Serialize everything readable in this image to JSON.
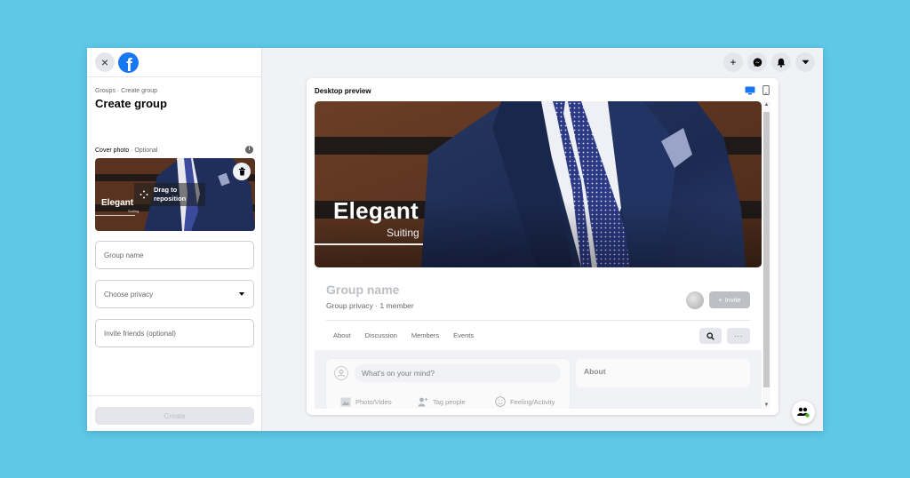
{
  "sidebar": {
    "close_label": "×",
    "logo_letter": "f",
    "breadcrumb": "Groups · Create group",
    "title": "Create group",
    "cover_label": "Cover photo",
    "cover_optional": " · Optional",
    "info_glyph": "i",
    "drag_hint_line1": "Drag to",
    "drag_hint_line2": "reposition",
    "thumb_brand": "Elegant",
    "thumb_sub": "Suiting",
    "fields": {
      "group_name_placeholder": "Group name",
      "privacy_placeholder": "Choose privacy",
      "invite_placeholder": "Invite friends (optional)"
    },
    "create_label": "Create"
  },
  "top_actions": [
    {
      "icon": "plus-icon",
      "glyph": "+"
    },
    {
      "icon": "messenger-icon"
    },
    {
      "icon": "bell-icon"
    },
    {
      "icon": "caret-down-icon"
    }
  ],
  "preview": {
    "title": "Desktop preview",
    "active_device": "desktop",
    "cover_brand": "Elegant",
    "cover_sub": "Suiting",
    "group_name": "Group name",
    "group_meta": "Group privacy · 1 member",
    "invite_label": "Invite",
    "tabs": [
      "About",
      "Discussion",
      "Members",
      "Events"
    ],
    "more_label": "···",
    "composer_placeholder": "What's on your mind?",
    "composer_actions": [
      "Photo/Video",
      "Tag people",
      "Feeling/Activity"
    ],
    "about_card_title": "About"
  },
  "colors": {
    "brand_blue": "#1877f2",
    "page_bg": "#5ec8e6",
    "panel_bg": "#f0f2f5",
    "button_gray": "#e4e6eb",
    "presence_green": "#42b72a"
  }
}
